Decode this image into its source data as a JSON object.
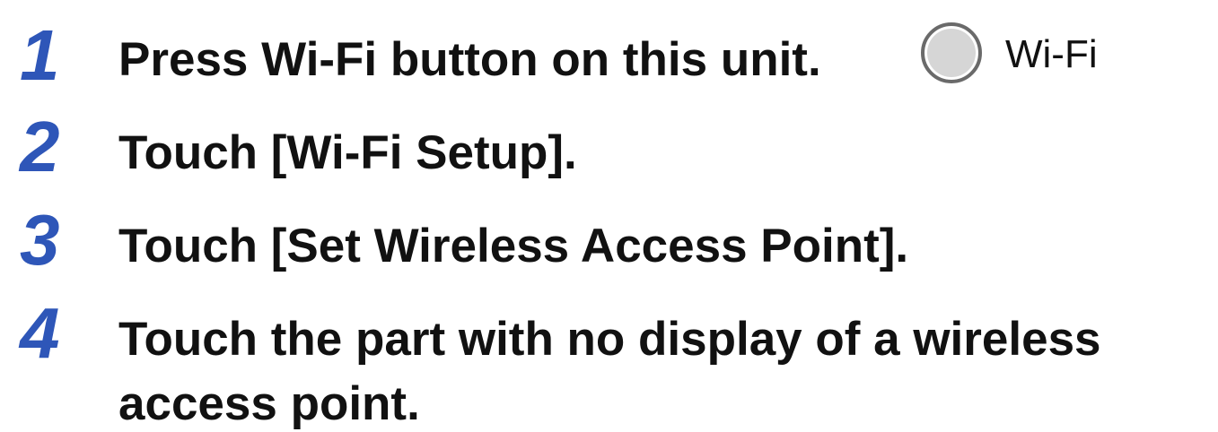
{
  "steps": [
    {
      "number": "1",
      "text": "Press Wi-Fi button on this unit.",
      "button_label": "Wi-Fi"
    },
    {
      "number": "2",
      "text": "Touch [Wi-Fi Setup]."
    },
    {
      "number": "3",
      "text": "Touch [Set Wireless Access Point]."
    },
    {
      "number": "4",
      "text": "Touch the part with no display of a wireless",
      "text_line2": "access point."
    }
  ],
  "colors": {
    "step_number": "#2e56b8",
    "text": "#111111",
    "button_fill": "#d6d6d6",
    "button_border": "#6a6a6a"
  },
  "icons": {
    "wifi_button": "circle-button-icon"
  }
}
